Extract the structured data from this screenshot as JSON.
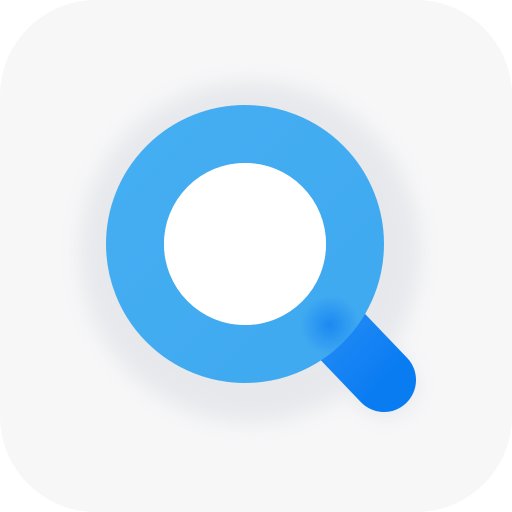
{
  "app_icon": {
    "icon": "magnifying-glass-icon",
    "colors": {
      "tile_background": "#f7f7f8",
      "lens_ring": "#3fa9f0",
      "lens_ring_light": "#45aef2",
      "handle": "#0a7cf2",
      "handle_highlight": "#1e88f5",
      "lens_inner": "#ffffff",
      "shadow": "#c9ced6"
    }
  }
}
